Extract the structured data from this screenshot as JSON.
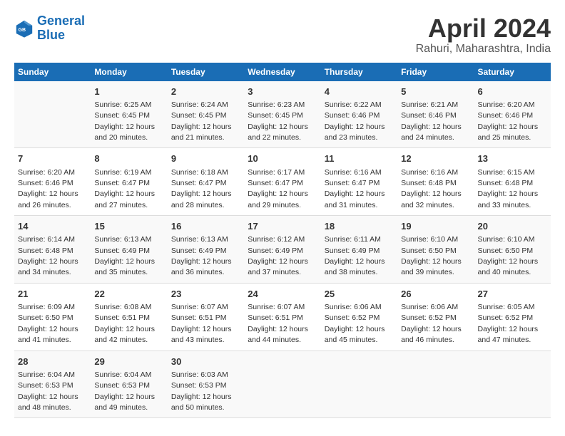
{
  "header": {
    "logo_line1": "General",
    "logo_line2": "Blue",
    "title": "April 2024",
    "subtitle": "Rahuri, Maharashtra, India"
  },
  "days_of_week": [
    "Sunday",
    "Monday",
    "Tuesday",
    "Wednesday",
    "Thursday",
    "Friday",
    "Saturday"
  ],
  "weeks": [
    [
      {
        "day": "",
        "info": ""
      },
      {
        "day": "1",
        "info": "Sunrise: 6:25 AM\nSunset: 6:45 PM\nDaylight: 12 hours\nand 20 minutes."
      },
      {
        "day": "2",
        "info": "Sunrise: 6:24 AM\nSunset: 6:45 PM\nDaylight: 12 hours\nand 21 minutes."
      },
      {
        "day": "3",
        "info": "Sunrise: 6:23 AM\nSunset: 6:45 PM\nDaylight: 12 hours\nand 22 minutes."
      },
      {
        "day": "4",
        "info": "Sunrise: 6:22 AM\nSunset: 6:46 PM\nDaylight: 12 hours\nand 23 minutes."
      },
      {
        "day": "5",
        "info": "Sunrise: 6:21 AM\nSunset: 6:46 PM\nDaylight: 12 hours\nand 24 minutes."
      },
      {
        "day": "6",
        "info": "Sunrise: 6:20 AM\nSunset: 6:46 PM\nDaylight: 12 hours\nand 25 minutes."
      }
    ],
    [
      {
        "day": "7",
        "info": "Sunrise: 6:20 AM\nSunset: 6:46 PM\nDaylight: 12 hours\nand 26 minutes."
      },
      {
        "day": "8",
        "info": "Sunrise: 6:19 AM\nSunset: 6:47 PM\nDaylight: 12 hours\nand 27 minutes."
      },
      {
        "day": "9",
        "info": "Sunrise: 6:18 AM\nSunset: 6:47 PM\nDaylight: 12 hours\nand 28 minutes."
      },
      {
        "day": "10",
        "info": "Sunrise: 6:17 AM\nSunset: 6:47 PM\nDaylight: 12 hours\nand 29 minutes."
      },
      {
        "day": "11",
        "info": "Sunrise: 6:16 AM\nSunset: 6:47 PM\nDaylight: 12 hours\nand 31 minutes."
      },
      {
        "day": "12",
        "info": "Sunrise: 6:16 AM\nSunset: 6:48 PM\nDaylight: 12 hours\nand 32 minutes."
      },
      {
        "day": "13",
        "info": "Sunrise: 6:15 AM\nSunset: 6:48 PM\nDaylight: 12 hours\nand 33 minutes."
      }
    ],
    [
      {
        "day": "14",
        "info": "Sunrise: 6:14 AM\nSunset: 6:48 PM\nDaylight: 12 hours\nand 34 minutes."
      },
      {
        "day": "15",
        "info": "Sunrise: 6:13 AM\nSunset: 6:49 PM\nDaylight: 12 hours\nand 35 minutes."
      },
      {
        "day": "16",
        "info": "Sunrise: 6:13 AM\nSunset: 6:49 PM\nDaylight: 12 hours\nand 36 minutes."
      },
      {
        "day": "17",
        "info": "Sunrise: 6:12 AM\nSunset: 6:49 PM\nDaylight: 12 hours\nand 37 minutes."
      },
      {
        "day": "18",
        "info": "Sunrise: 6:11 AM\nSunset: 6:49 PM\nDaylight: 12 hours\nand 38 minutes."
      },
      {
        "day": "19",
        "info": "Sunrise: 6:10 AM\nSunset: 6:50 PM\nDaylight: 12 hours\nand 39 minutes."
      },
      {
        "day": "20",
        "info": "Sunrise: 6:10 AM\nSunset: 6:50 PM\nDaylight: 12 hours\nand 40 minutes."
      }
    ],
    [
      {
        "day": "21",
        "info": "Sunrise: 6:09 AM\nSunset: 6:50 PM\nDaylight: 12 hours\nand 41 minutes."
      },
      {
        "day": "22",
        "info": "Sunrise: 6:08 AM\nSunset: 6:51 PM\nDaylight: 12 hours\nand 42 minutes."
      },
      {
        "day": "23",
        "info": "Sunrise: 6:07 AM\nSunset: 6:51 PM\nDaylight: 12 hours\nand 43 minutes."
      },
      {
        "day": "24",
        "info": "Sunrise: 6:07 AM\nSunset: 6:51 PM\nDaylight: 12 hours\nand 44 minutes."
      },
      {
        "day": "25",
        "info": "Sunrise: 6:06 AM\nSunset: 6:52 PM\nDaylight: 12 hours\nand 45 minutes."
      },
      {
        "day": "26",
        "info": "Sunrise: 6:06 AM\nSunset: 6:52 PM\nDaylight: 12 hours\nand 46 minutes."
      },
      {
        "day": "27",
        "info": "Sunrise: 6:05 AM\nSunset: 6:52 PM\nDaylight: 12 hours\nand 47 minutes."
      }
    ],
    [
      {
        "day": "28",
        "info": "Sunrise: 6:04 AM\nSunset: 6:53 PM\nDaylight: 12 hours\nand 48 minutes."
      },
      {
        "day": "29",
        "info": "Sunrise: 6:04 AM\nSunset: 6:53 PM\nDaylight: 12 hours\nand 49 minutes."
      },
      {
        "day": "30",
        "info": "Sunrise: 6:03 AM\nSunset: 6:53 PM\nDaylight: 12 hours\nand 50 minutes."
      },
      {
        "day": "",
        "info": ""
      },
      {
        "day": "",
        "info": ""
      },
      {
        "day": "",
        "info": ""
      },
      {
        "day": "",
        "info": ""
      }
    ]
  ]
}
